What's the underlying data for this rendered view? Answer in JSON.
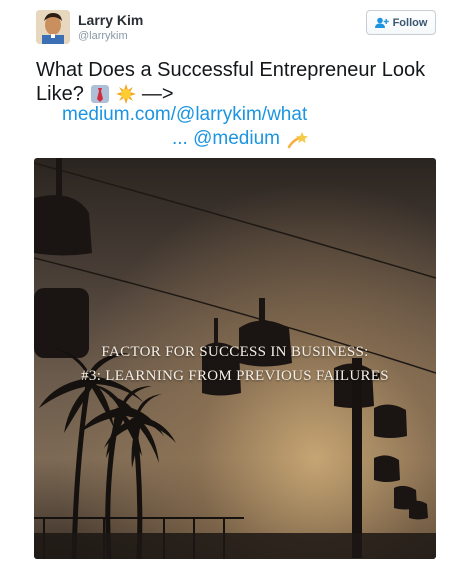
{
  "user": {
    "name": "Larry Kim",
    "handle": "@larrykim"
  },
  "follow_button": {
    "label": "Follow",
    "icon": "add-person-icon"
  },
  "tweet": {
    "line1": "What Does a Successful Entrepreneur Look",
    "line2_prefix": "Like?",
    "emojis": [
      "necktie-emoji",
      "sun-emoji"
    ],
    "arrow": "—>",
    "link_line1": "medium.com/@larrykim/what",
    "link_line2": "... @medium",
    "link_emoji": "dizzy-emoji"
  },
  "photo": {
    "caption_line1": "FACTOR FOR SUCCESS IN BUSINESS:",
    "caption_line2": "#3: LEARNING FROM PREVIOUS FAILURES"
  },
  "colors": {
    "link": "#1b95e0",
    "handle": "#8899a6",
    "text": "#14171a"
  }
}
